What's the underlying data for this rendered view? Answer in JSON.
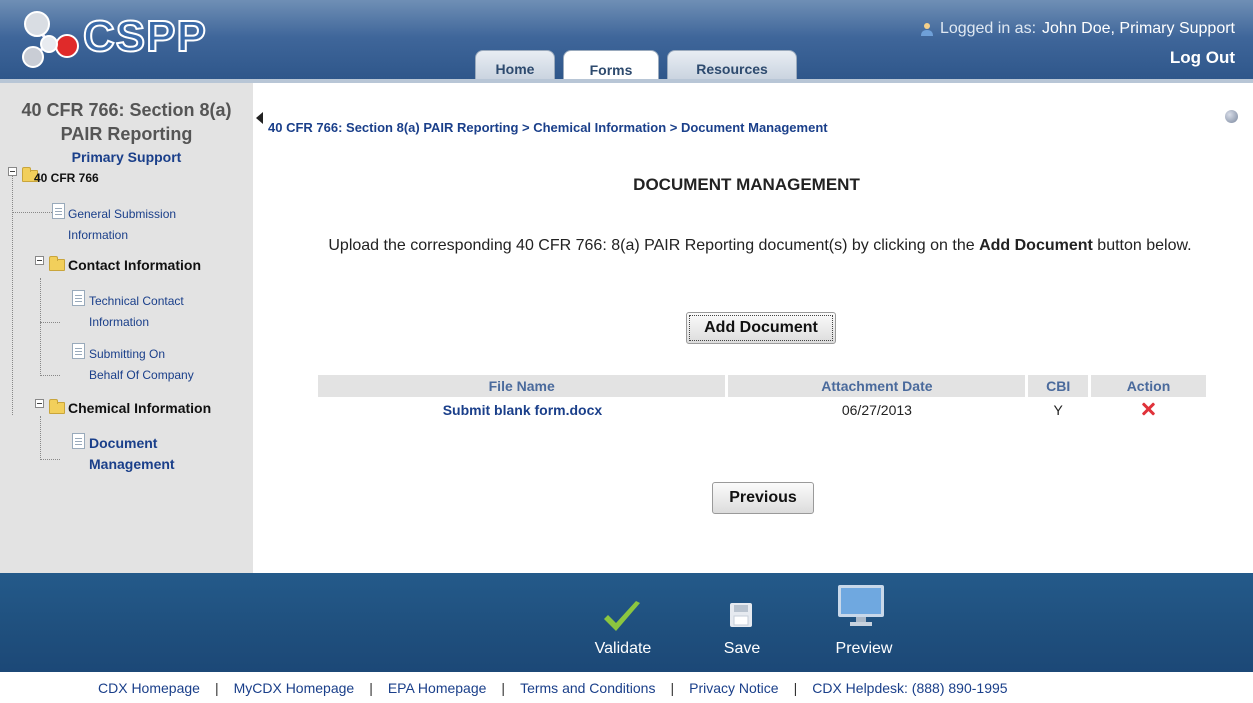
{
  "header": {
    "logo_text": "CSPP",
    "tabs": [
      {
        "label": "Home",
        "active": false
      },
      {
        "label": "Forms",
        "active": true
      },
      {
        "label": "Resources",
        "active": false
      }
    ],
    "login_prefix": "Logged in as:",
    "login_user": "John Doe, Primary Support",
    "logout_label": "Log Out"
  },
  "sidebar": {
    "title_line1": "40 CFR 766: Section 8(a)",
    "title_line2": "PAIR Reporting",
    "role": "Primary Support",
    "tree": {
      "root": "40 CFR 766",
      "general_line1": "General Submission",
      "general_line2": "Information",
      "contact": "Contact Information",
      "technical_line1": "Technical Contact",
      "technical_line2": "Information",
      "behalf_line1": "Submitting On",
      "behalf_line2": "Behalf Of Company",
      "chemical": "Chemical Information",
      "docmgmt_line1": "Document",
      "docmgmt_line2": "Management"
    }
  },
  "main": {
    "breadcrumb": "40 CFR 766: Section 8(a) PAIR Reporting > Chemical Information > Document Management",
    "title": "DOCUMENT MANAGEMENT",
    "instr_pre": "Upload the corresponding 40 CFR 766: 8(a) PAIR Reporting document(s) by clicking on the ",
    "instr_bold": "Add Document",
    "instr_post": " button below.",
    "add_button": "Add Document",
    "previous_button": "Previous",
    "table": {
      "headers": [
        "File Name",
        "Attachment Date",
        "CBI",
        "Action"
      ],
      "rows": [
        {
          "file_name": "Submit blank form.docx",
          "date": "06/27/2013",
          "cbi": "Y"
        }
      ]
    }
  },
  "toolbar": {
    "validate": "Validate",
    "save": "Save",
    "preview": "Preview"
  },
  "footer": {
    "links": [
      "CDX Homepage",
      "MyCDX Homepage",
      "EPA Homepage",
      "Terms and Conditions",
      "Privacy Notice",
      "CDX Helpdesk: (888) 890-1995"
    ]
  },
  "colors": {
    "header_blue": "#3f669a",
    "link_blue": "#1a3f8a",
    "toolbar_blue": "#1f4f7d",
    "delete_red": "#e0323a",
    "check_green": "#8cc63f"
  }
}
